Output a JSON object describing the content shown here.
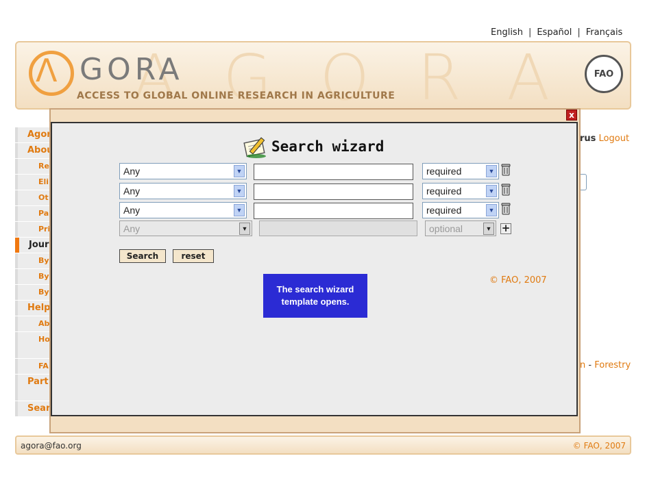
{
  "languages": [
    "English",
    "Español",
    "Français"
  ],
  "header": {
    "logo_text": "GORA",
    "tagline": "ACCESS TO GLOBAL ONLINE RESEARCH IN AGRICULTURE",
    "fao_seal": "FAO"
  },
  "sidebar": {
    "items": [
      {
        "label": "Agora",
        "level": "top"
      },
      {
        "label": "About",
        "level": "top"
      },
      {
        "label": "Re",
        "level": "sub"
      },
      {
        "label": "Eli",
        "level": "sub"
      },
      {
        "label": "Ot",
        "level": "sub"
      },
      {
        "label": "Pa",
        "level": "sub"
      },
      {
        "label": "Pri",
        "level": "sub"
      },
      {
        "label": "Jour",
        "level": "top",
        "active": true
      },
      {
        "label": "By",
        "level": "sub"
      },
      {
        "label": "By",
        "level": "sub"
      },
      {
        "label": "By",
        "level": "sub"
      },
      {
        "label": "Help",
        "level": "top"
      },
      {
        "label": "Ab",
        "level": "sub"
      },
      {
        "label": "Ho jou",
        "level": "sub"
      },
      {
        "label": "FA",
        "level": "sub"
      },
      {
        "label": "Part Login",
        "level": "top"
      },
      {
        "label": "Search",
        "level": "top"
      }
    ]
  },
  "user_area": {
    "user_suffix": "rus",
    "logout_label": "Logout"
  },
  "bottom_links": {
    "partial": "n",
    "separator": "-",
    "forestry": "Forestry"
  },
  "footer": {
    "email": "agora@fao.org",
    "copyright": "© FAO, 2007"
  },
  "modal": {
    "close_label": "x",
    "title": "Search wizard",
    "rows": [
      {
        "field": "Any",
        "term": "",
        "condition": "required",
        "enabled": true
      },
      {
        "field": "Any",
        "term": "",
        "condition": "required",
        "enabled": true
      },
      {
        "field": "Any",
        "term": "",
        "condition": "required",
        "enabled": true
      },
      {
        "field": "Any",
        "term": "",
        "condition": "optional",
        "enabled": false
      }
    ],
    "search_button": "Search",
    "reset_button": "reset",
    "copyright": "© FAO, 2007"
  },
  "callout": {
    "text": "The search wizard template opens."
  }
}
